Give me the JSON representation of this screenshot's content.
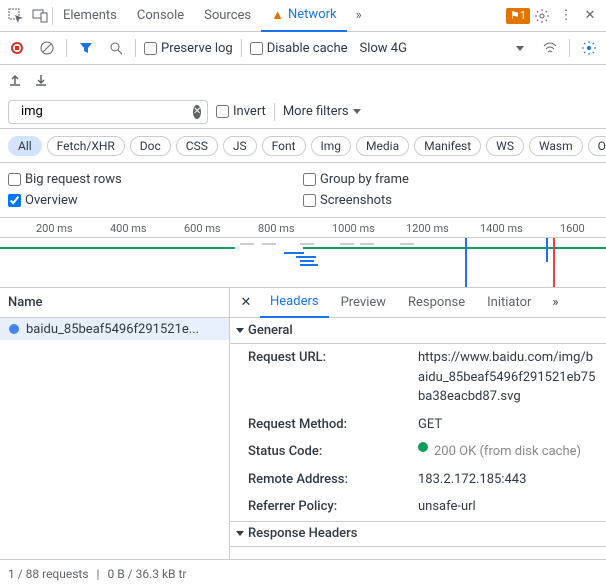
{
  "tabs": [
    "Elements",
    "Console",
    "Sources",
    "Network"
  ],
  "activeTab": 3,
  "warnCount": "1",
  "toolbar": {
    "preserve": "Preserve log",
    "disableCache": "Disable cache",
    "throttle": "Slow 4G"
  },
  "filter": {
    "value": "img",
    "invert": "Invert",
    "more": "More filters"
  },
  "types": [
    "All",
    "Fetch/XHR",
    "Doc",
    "CSS",
    "JS",
    "Font",
    "Img",
    "Media",
    "Manifest",
    "WS",
    "Wasm",
    "Other"
  ],
  "opts": {
    "bigRows": "Big request rows",
    "group": "Group by frame",
    "overview": "Overview",
    "screenshots": "Screenshots"
  },
  "timeline": {
    "ticks": [
      "200 ms",
      "400 ms",
      "600 ms",
      "800 ms",
      "1000 ms",
      "1200 ms",
      "1400 ms",
      "1600"
    ]
  },
  "nameHeader": "Name",
  "request": {
    "name": "baidu_85beaf5496f291521e..."
  },
  "detTabs": [
    "Headers",
    "Preview",
    "Response",
    "Initiator"
  ],
  "sections": {
    "general": "General",
    "respHdr": "Response Headers"
  },
  "general": {
    "url_k": "Request URL:",
    "url_v": "https://www.baidu.com/img/baidu_85beaf5496f291521eb75ba38eacbd87.svg",
    "method_k": "Request Method:",
    "method_v": "GET",
    "status_k": "Status Code:",
    "status_v": "200 OK (from disk cache)",
    "remote_k": "Remote Address:",
    "remote_v": "183.2.172.185:443",
    "ref_k": "Referrer Policy:",
    "ref_v": "unsafe-url"
  },
  "footer": {
    "reqs": "1 / 88 requests",
    "xfer": "0 B / 36.3 kB tr"
  }
}
